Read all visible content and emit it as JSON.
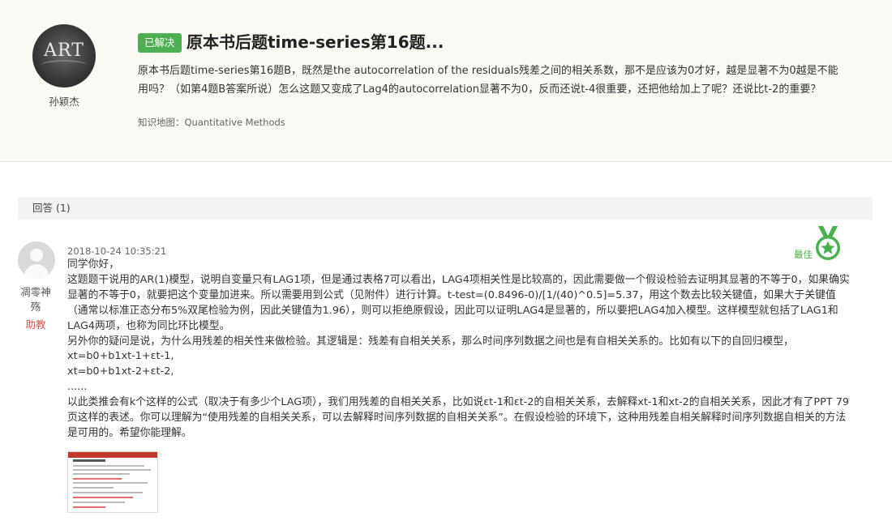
{
  "question": {
    "author": "孙颖杰",
    "avatar_text": "ART",
    "status_badge": "已解决",
    "title": "原本书后题time-series第16题...",
    "body": "原本书后题time-series第16题B，既然是the autocorrelation of the residuals残差之间的相关系数，那不是应该为0才好，越是显著不为0越是不能用吗？（如第4题B答案所说）怎么这题又变成了Lag4的autocorrelation显著不为0，反而还说t-4很重要，还把他给加上了呢？还说比t-2的重要？",
    "tag": "知识地图：Quantitative Methods"
  },
  "answers_header": "回答 (1)",
  "answer": {
    "author": "凋零神殇",
    "role": "助教",
    "time": "2018-10-24 10:35:21",
    "best_label": "最佳",
    "paragraphs": [
      "同学你好，",
      "这题题干说用的AR(1)模型，说明自变量只有LAG1项，但是通过表格7可以看出，LAG4项相关性是比较高的，因此需要做一个假设检验去证明其显著的不等于0，如果确实显著的不等于0，就要把这个变量加进来。所以需要用到公式（见附件）进行计算。t-test=(0.8496-0)/[1/(40)^0.5]=5.37，用这个数去比较关键值，如果大于关键值（通常以标准正态分布5%双尾检验为例，因此关键值为1.96），则可以拒绝原假设，因此可以证明LAG4是显著的，所以要把LAG4加入模型。这样模型就包括了LAG1和LAG4两项，也称为同比环比模型。",
      "另外你的疑问是说，为什么用残差的相关性来做检验。其逻辑是：残差有自相关关系，那么时间序列数据之间也是有自相关关系的。比如有以下的自回归模型，",
      "xt=b0+b1xt-1+εt-1,",
      "xt=b0+b1xt-2+εt-2,",
      "......",
      "以此类推会有k个这样的公式（取决于有多少个LAG项），我们用残差的自相关关系，比如说εt-1和εt-2的自相关关系，去解释xt-1和xt-2的自相关关系，因此才有了PPT 79页这样的表述。你可以理解为“使用残差的自相关关系，可以去解释时间序列数据的自相关关系”。在假设检验的环境下，这种用残差自相关解释时间序列数据自相关的方法是可用的。希望你能理解。"
    ]
  }
}
